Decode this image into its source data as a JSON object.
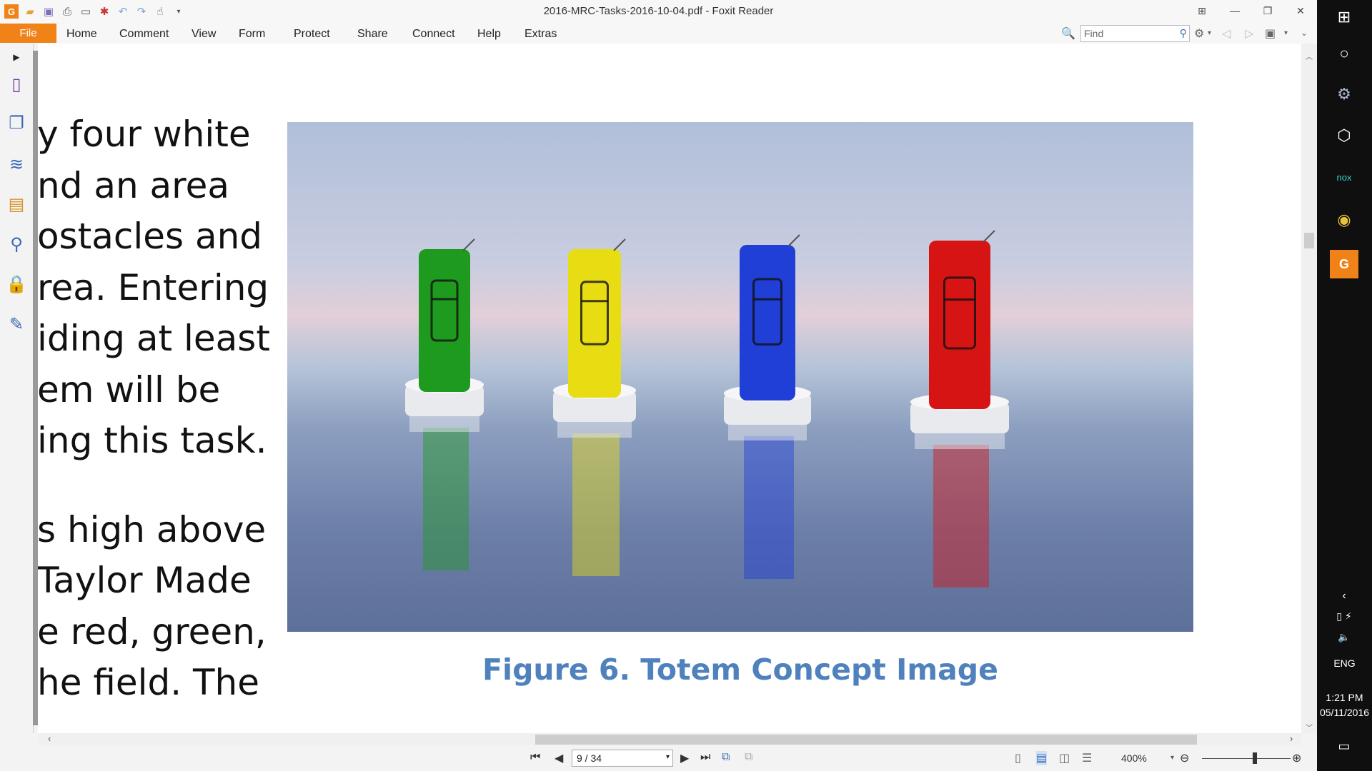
{
  "window": {
    "title": "2016-MRC-Tasks-2016-10-04.pdf - Foxit Reader"
  },
  "menu": {
    "file": "File",
    "items": [
      "Home",
      "Comment",
      "View",
      "Form",
      "Protect",
      "Share",
      "Connect",
      "Help",
      "Extras"
    ]
  },
  "search": {
    "placeholder": "Find"
  },
  "document": {
    "text_lines": [
      "y four white",
      "nd  an  area",
      "ostacles  and",
      "rea.  Entering",
      "iding at least",
      "em  will  be",
      "ing this task.",
      "s high above",
      "Taylor  Made",
      "e red, green,",
      "he field. The"
    ],
    "figure_caption": "Figure 6. Totem Concept Image",
    "totem_colors": [
      "#1e9a1e",
      "#e8dc12",
      "#1f3fd6",
      "#d61414"
    ]
  },
  "statusbar": {
    "page_indicator": "9 / 34",
    "zoom_level": "400%"
  },
  "taskbar": {
    "language": "ENG",
    "time": "1:21 PM",
    "date": "05/11/2016"
  }
}
